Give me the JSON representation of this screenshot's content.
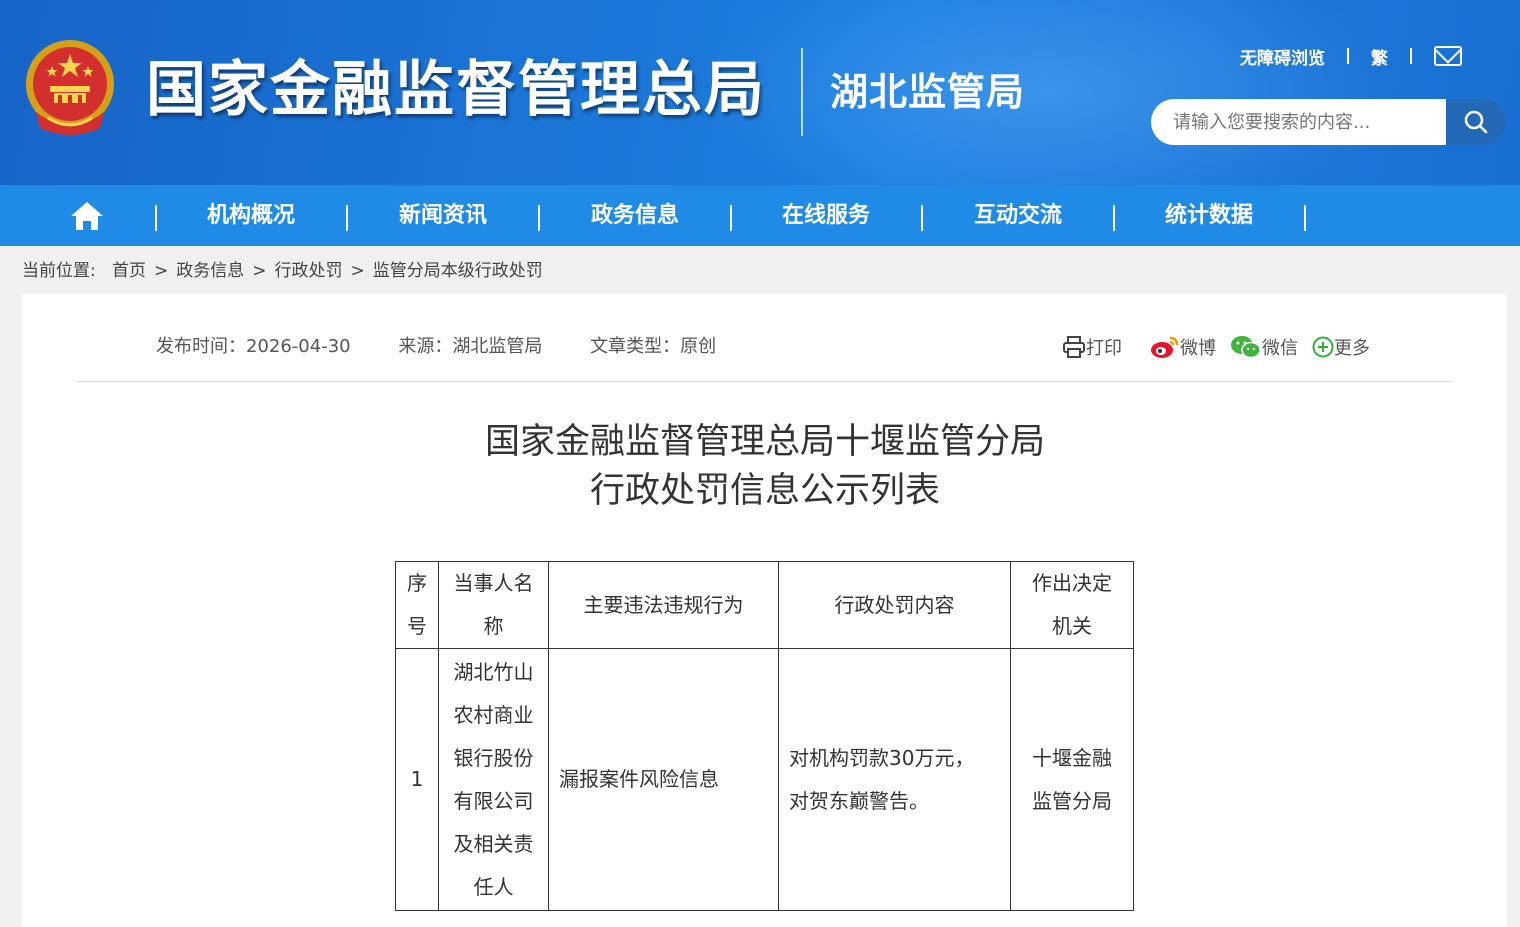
{
  "header": {
    "org_title": "国家金融监督管理总局",
    "sub_title": "湖北监管局",
    "links": {
      "accessible": "无障碍浏览",
      "traditional": "繁"
    },
    "search": {
      "placeholder": "请输入您要搜索的内容..."
    }
  },
  "nav": {
    "items": [
      {
        "label": "机构概况"
      },
      {
        "label": "新闻资讯"
      },
      {
        "label": "政务信息"
      },
      {
        "label": "在线服务"
      },
      {
        "label": "互动交流"
      },
      {
        "label": "统计数据"
      }
    ]
  },
  "breadcrumb": {
    "prefix": "当前位置:",
    "items": [
      "首页",
      "政务信息",
      "行政处罚",
      "监管分局本级行政处罚"
    ],
    "separator": ">"
  },
  "meta": {
    "publish": "发布时间：2026-04-30",
    "source": "来源：湖北监管局",
    "type": "文章类型：原创"
  },
  "share": {
    "print": "打印",
    "weibo": "微博",
    "wechat": "微信",
    "more": "更多"
  },
  "document": {
    "title_line1": "国家金融监督管理总局十堰监管分局",
    "title_line2": "行政处罚信息公示列表"
  },
  "table": {
    "headers": {
      "seq_l1": "序",
      "seq_l2": "号",
      "party_l1": "当事人名",
      "party_l2": "称",
      "violation": "主要违法违规行为",
      "penalty": "行政处罚内容",
      "org_l1": "作出决定",
      "org_l2": "机关"
    },
    "rows": [
      {
        "seq": "1",
        "party_lines": [
          "湖北竹山",
          "农村商业",
          "银行股份",
          "有限公司",
          "及相关责",
          "任人"
        ],
        "violation": "漏报案件风险信息",
        "penalty_lines": [
          "对机构罚款30万元，",
          "对贺东巅警告。"
        ],
        "org_lines": [
          "十堰金融",
          "监管分局"
        ]
      }
    ]
  },
  "colors": {
    "header_blue": "#1a74d6",
    "nav_blue": "#1f8be6",
    "search_btn": "#2469b8"
  }
}
